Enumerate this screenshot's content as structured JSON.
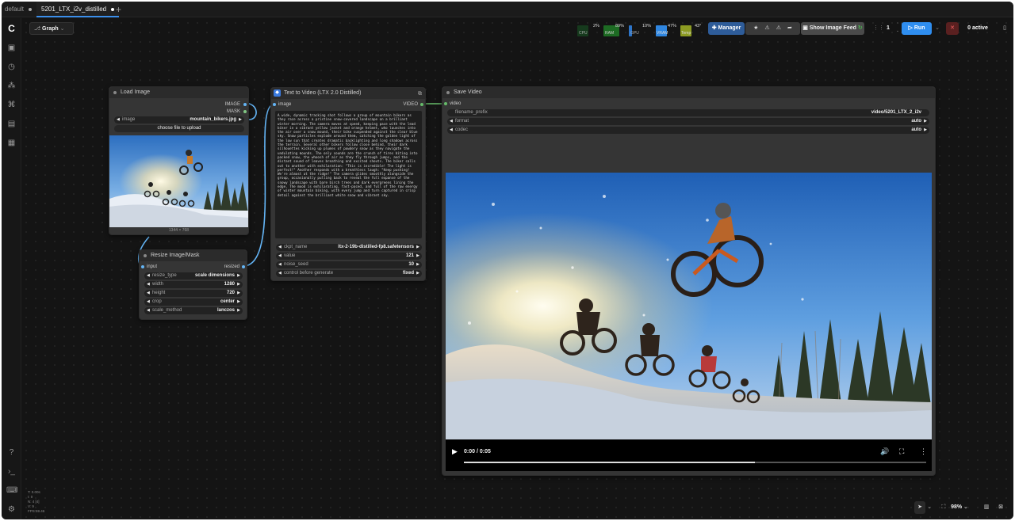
{
  "tabs": [
    {
      "label": "default"
    },
    {
      "label": "5201_LTX_i2v_distilled"
    }
  ],
  "toolbar": {
    "graph_label": "Graph",
    "stats": [
      {
        "label": "CPU",
        "value": "2%"
      },
      {
        "label": "RAM",
        "value": "89%"
      },
      {
        "label": "GPU",
        "value": "10%"
      },
      {
        "label": "VRAM",
        "value": "47%"
      },
      {
        "label": "Temp",
        "value": "43°"
      }
    ],
    "manager_label": "Manager",
    "show_feed_label": "Show Image Feed",
    "queue_count": "1",
    "run_label": "Run",
    "active_label": "0 active"
  },
  "nodes": {
    "load_image": {
      "title": "Load Image",
      "outputs": [
        "IMAGE",
        "MASK"
      ],
      "image_widget_label": "image",
      "image_widget_value": "mountain_bikers.jpg",
      "upload_label": "choose file to upload",
      "dimensions": "1344 × 768"
    },
    "resize": {
      "title": "Resize Image/Mask",
      "input_label": "input",
      "output_label": "resized",
      "widgets": [
        {
          "label": "resize_type",
          "value": "scale dimensions"
        },
        {
          "label": "width",
          "value": "1280"
        },
        {
          "label": "height",
          "value": "720"
        },
        {
          "label": "crop",
          "value": "center"
        },
        {
          "label": "scale_method",
          "value": "lanczos"
        }
      ]
    },
    "t2v": {
      "title": "Text to Video (LTX 2.0 Distilled)",
      "input_label": "image",
      "output_label": "VIDEO",
      "prompt": "A wide, dynamic tracking shot follows a group of mountain bikers as they race across a pristine snow-covered landscape on a brilliant winter morning. The camera moves at speed, keeping pace with the lead biker in a vibrant yellow jacket and orange helmet, who launches into the air over a snow mound, their bike suspended against the clear blue sky. Snow particles explode around them, catching the golden light of the low sun that creates dramatic backlighting and long shadows across the terrain. Several other bikers follow close behind, their dark silhouettes kicking up plumes of powdery snow as they navigate the undulating mounds. The only sounds are the crunch of tires biting into packed snow, the whoosh of air as they fly through jumps, and the distant sound of leaves breathing and excited shouts. The biker calls out to another with exhilaration: \"This is incredible! The light is perfect!\" Another responds with a breathless laugh: \"Keep pushing! We're almost at the ridge!\" The camera glides smoothly alongside the group, occasionally pulling back to reveal the full expanse of the snowy landscape with bare birch trees and dark evergreens lining the edge. The mood is exhilarating, fast-paced, and full of the raw energy of winter mountain biking, with every jump and turn captured in crisp detail against the brilliant white snow and vibrant sky.",
      "widgets": [
        {
          "label": "ckpt_name",
          "value": "ltx-2-19b-distilled-fp8.safetensors"
        },
        {
          "label": "value",
          "value": "121"
        },
        {
          "label": "noise_seed",
          "value": "10"
        },
        {
          "label": "control before generate",
          "value": "fixed"
        }
      ]
    },
    "save_video": {
      "title": "Save Video",
      "input_label": "video",
      "widgets": [
        {
          "label": "filename_prefix",
          "value": "video/5201_LTX_2_i2v"
        },
        {
          "label": "format",
          "value": "auto"
        },
        {
          "label": "codec",
          "value": "auto"
        }
      ],
      "time": "0:00 / 0:05",
      "progress": 0.63
    }
  },
  "bottom_right": {
    "zoom": "98%"
  },
  "bottom_left": [
    "T: 0.00s",
    "I: 0",
    "N: 4 [4]",
    "V: 9",
    "FPS:59.46"
  ]
}
